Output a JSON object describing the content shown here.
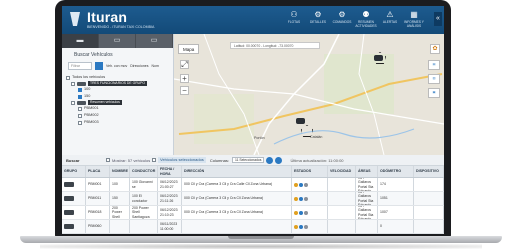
{
  "header": {
    "brand": "Ituran",
    "account": "BIENVENIDO - ITURAN TAXI COLOMBIA",
    "nav": [
      {
        "icon": "people-icon",
        "glyph": "⚇",
        "label": "FLOTAS"
      },
      {
        "icon": "gear-icon",
        "glyph": "⚙",
        "label": "DETALLES"
      },
      {
        "icon": "settings-icon",
        "glyph": "⚙",
        "label": "COMANDOS"
      },
      {
        "icon": "group-icon",
        "glyph": "⚉",
        "label": "RESUMEN ACTIVIDADES"
      },
      {
        "icon": "bell-icon",
        "glyph": "⚠",
        "label": "ALERTAS"
      },
      {
        "icon": "report-icon",
        "glyph": "▦",
        "label": "INFORMES Y ANÁLISIS"
      }
    ],
    "collapse": "«"
  },
  "left": {
    "title": "Buscar Vehículos",
    "filter_placeholder": "Filtrar",
    "filter_buttons": [
      "Veh. con mov",
      "Direcciones",
      "Nom"
    ],
    "tree": [
      {
        "text": "Todos los vehículos",
        "kind": "root"
      },
      {
        "text": "TRES FUNCIONARIOS DE GRUPO",
        "kind": "group"
      },
      {
        "text": "100",
        "kind": "item"
      },
      {
        "text": "150",
        "kind": "item"
      },
      {
        "text": "Resumen vehículos",
        "kind": "group"
      },
      {
        "text": "PBM001",
        "kind": "item"
      },
      {
        "text": "PBM002",
        "kind": "item"
      },
      {
        "text": "PBM003",
        "kind": "item"
      }
    ]
  },
  "map": {
    "tab": "Mapa",
    "coords": "Latitud: 00.00070 - Longitud: -73.00070",
    "towns": [
      "Portón",
      "Catalán"
    ]
  },
  "grid": {
    "toolbar_title": "Buscar",
    "toolbar_count": "Mostrar: 57 vehículos",
    "toolbar_selected": "Vehículos seleccionados",
    "toolbar_columns": "Columnas:",
    "toolbar_columns_sel": "11 Seleccionados",
    "toolbar_updated": "Última actualización: 11:00:00",
    "columns": [
      "GRUPO",
      "PLACA",
      "NOMBRE",
      "CONDUCTOR",
      "FECHA / HORA",
      "DIRECCIÓN",
      "ESTADOS",
      "VELOCIDAD",
      "ÁREAS",
      "ODÓMETRO",
      "DISPOSITIVO"
    ],
    "rows": [
      {
        "placa": "PBM001",
        "nombre": "100",
        "conductor": "100 Giovanni se",
        "fecha": "06/12/2023 21:00:27",
        "direccion": "000 Cll y Cra (Carrera 3 Cll y Cra Calle Cll Zona Urbana)",
        "velocidad": "",
        "areas": "JS / Gallaros Portal Sta Eduardo",
        "odometro": "174",
        "dispositivo": ""
      },
      {
        "placa": "PBM011",
        "nombre": "150",
        "conductor": "100 El conductor",
        "fecha": "06/12/2023 21:11:26",
        "direccion": "000 Cll y Cra (Carrera 3 Cll y Cra Cll Zona Urbana)",
        "velocidad": "",
        "areas": "JS / Gallaros Portal Sta Eduardo",
        "odometro": "1051",
        "dispositivo": ""
      },
      {
        "placa": "PBM018",
        "nombre": "200 Power Shell",
        "conductor": "200 Power Shell Santiagoza",
        "fecha": "06/12/2023 21:10:23",
        "direccion": "000 Cll y Cra (Carrera 3 Cll y Cra Cll Zona Urbana)",
        "velocidad": "",
        "areas": "JS / Gallaros Portal Sta Eduardo",
        "odometro": "1007",
        "dispositivo": ""
      },
      {
        "placa": "PBM060",
        "nombre": "",
        "conductor": "",
        "fecha": "06/11/2023 11:00:00",
        "direccion": "",
        "velocidad": "",
        "areas": "",
        "odometro": "0",
        "dispositivo": ""
      }
    ]
  },
  "colors": {
    "header": "#1d5b8f",
    "accent": "#2b79c2"
  }
}
